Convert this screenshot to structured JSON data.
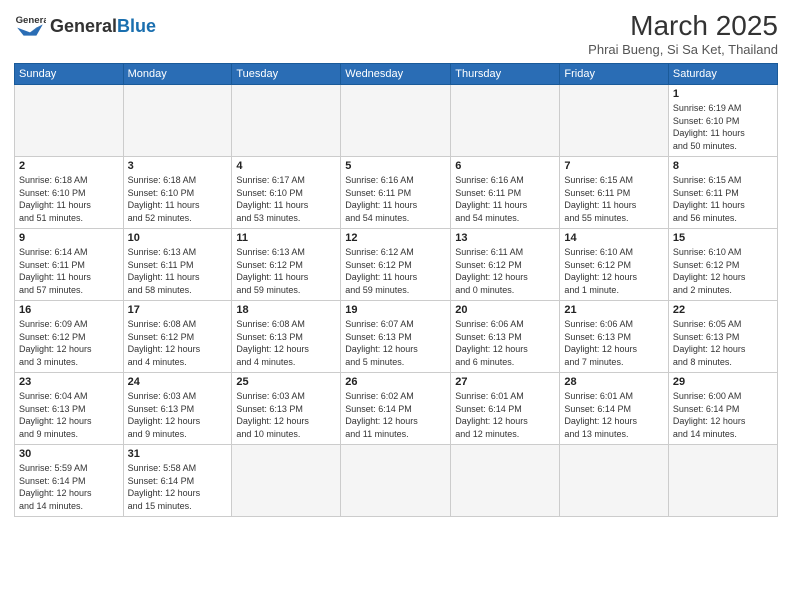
{
  "header": {
    "logo_general": "General",
    "logo_blue": "Blue",
    "month_title": "March 2025",
    "subtitle": "Phrai Bueng, Si Sa Ket, Thailand"
  },
  "weekdays": [
    "Sunday",
    "Monday",
    "Tuesday",
    "Wednesday",
    "Thursday",
    "Friday",
    "Saturday"
  ],
  "weeks": [
    [
      {
        "day": "",
        "info": ""
      },
      {
        "day": "",
        "info": ""
      },
      {
        "day": "",
        "info": ""
      },
      {
        "day": "",
        "info": ""
      },
      {
        "day": "",
        "info": ""
      },
      {
        "day": "",
        "info": ""
      },
      {
        "day": "1",
        "info": "Sunrise: 6:19 AM\nSunset: 6:10 PM\nDaylight: 11 hours\nand 50 minutes."
      }
    ],
    [
      {
        "day": "2",
        "info": "Sunrise: 6:18 AM\nSunset: 6:10 PM\nDaylight: 11 hours\nand 51 minutes."
      },
      {
        "day": "3",
        "info": "Sunrise: 6:18 AM\nSunset: 6:10 PM\nDaylight: 11 hours\nand 52 minutes."
      },
      {
        "day": "4",
        "info": "Sunrise: 6:17 AM\nSunset: 6:10 PM\nDaylight: 11 hours\nand 53 minutes."
      },
      {
        "day": "5",
        "info": "Sunrise: 6:16 AM\nSunset: 6:11 PM\nDaylight: 11 hours\nand 54 minutes."
      },
      {
        "day": "6",
        "info": "Sunrise: 6:16 AM\nSunset: 6:11 PM\nDaylight: 11 hours\nand 54 minutes."
      },
      {
        "day": "7",
        "info": "Sunrise: 6:15 AM\nSunset: 6:11 PM\nDaylight: 11 hours\nand 55 minutes."
      },
      {
        "day": "8",
        "info": "Sunrise: 6:15 AM\nSunset: 6:11 PM\nDaylight: 11 hours\nand 56 minutes."
      }
    ],
    [
      {
        "day": "9",
        "info": "Sunrise: 6:14 AM\nSunset: 6:11 PM\nDaylight: 11 hours\nand 57 minutes."
      },
      {
        "day": "10",
        "info": "Sunrise: 6:13 AM\nSunset: 6:11 PM\nDaylight: 11 hours\nand 58 minutes."
      },
      {
        "day": "11",
        "info": "Sunrise: 6:13 AM\nSunset: 6:12 PM\nDaylight: 11 hours\nand 59 minutes."
      },
      {
        "day": "12",
        "info": "Sunrise: 6:12 AM\nSunset: 6:12 PM\nDaylight: 11 hours\nand 59 minutes."
      },
      {
        "day": "13",
        "info": "Sunrise: 6:11 AM\nSunset: 6:12 PM\nDaylight: 12 hours\nand 0 minutes."
      },
      {
        "day": "14",
        "info": "Sunrise: 6:10 AM\nSunset: 6:12 PM\nDaylight: 12 hours\nand 1 minute."
      },
      {
        "day": "15",
        "info": "Sunrise: 6:10 AM\nSunset: 6:12 PM\nDaylight: 12 hours\nand 2 minutes."
      }
    ],
    [
      {
        "day": "16",
        "info": "Sunrise: 6:09 AM\nSunset: 6:12 PM\nDaylight: 12 hours\nand 3 minutes."
      },
      {
        "day": "17",
        "info": "Sunrise: 6:08 AM\nSunset: 6:12 PM\nDaylight: 12 hours\nand 4 minutes."
      },
      {
        "day": "18",
        "info": "Sunrise: 6:08 AM\nSunset: 6:13 PM\nDaylight: 12 hours\nand 4 minutes."
      },
      {
        "day": "19",
        "info": "Sunrise: 6:07 AM\nSunset: 6:13 PM\nDaylight: 12 hours\nand 5 minutes."
      },
      {
        "day": "20",
        "info": "Sunrise: 6:06 AM\nSunset: 6:13 PM\nDaylight: 12 hours\nand 6 minutes."
      },
      {
        "day": "21",
        "info": "Sunrise: 6:06 AM\nSunset: 6:13 PM\nDaylight: 12 hours\nand 7 minutes."
      },
      {
        "day": "22",
        "info": "Sunrise: 6:05 AM\nSunset: 6:13 PM\nDaylight: 12 hours\nand 8 minutes."
      }
    ],
    [
      {
        "day": "23",
        "info": "Sunrise: 6:04 AM\nSunset: 6:13 PM\nDaylight: 12 hours\nand 9 minutes."
      },
      {
        "day": "24",
        "info": "Sunrise: 6:03 AM\nSunset: 6:13 PM\nDaylight: 12 hours\nand 9 minutes."
      },
      {
        "day": "25",
        "info": "Sunrise: 6:03 AM\nSunset: 6:13 PM\nDaylight: 12 hours\nand 10 minutes."
      },
      {
        "day": "26",
        "info": "Sunrise: 6:02 AM\nSunset: 6:14 PM\nDaylight: 12 hours\nand 11 minutes."
      },
      {
        "day": "27",
        "info": "Sunrise: 6:01 AM\nSunset: 6:14 PM\nDaylight: 12 hours\nand 12 minutes."
      },
      {
        "day": "28",
        "info": "Sunrise: 6:01 AM\nSunset: 6:14 PM\nDaylight: 12 hours\nand 13 minutes."
      },
      {
        "day": "29",
        "info": "Sunrise: 6:00 AM\nSunset: 6:14 PM\nDaylight: 12 hours\nand 14 minutes."
      }
    ],
    [
      {
        "day": "30",
        "info": "Sunrise: 5:59 AM\nSunset: 6:14 PM\nDaylight: 12 hours\nand 14 minutes."
      },
      {
        "day": "31",
        "info": "Sunrise: 5:58 AM\nSunset: 6:14 PM\nDaylight: 12 hours\nand 15 minutes."
      },
      {
        "day": "",
        "info": ""
      },
      {
        "day": "",
        "info": ""
      },
      {
        "day": "",
        "info": ""
      },
      {
        "day": "",
        "info": ""
      },
      {
        "day": "",
        "info": ""
      }
    ]
  ]
}
